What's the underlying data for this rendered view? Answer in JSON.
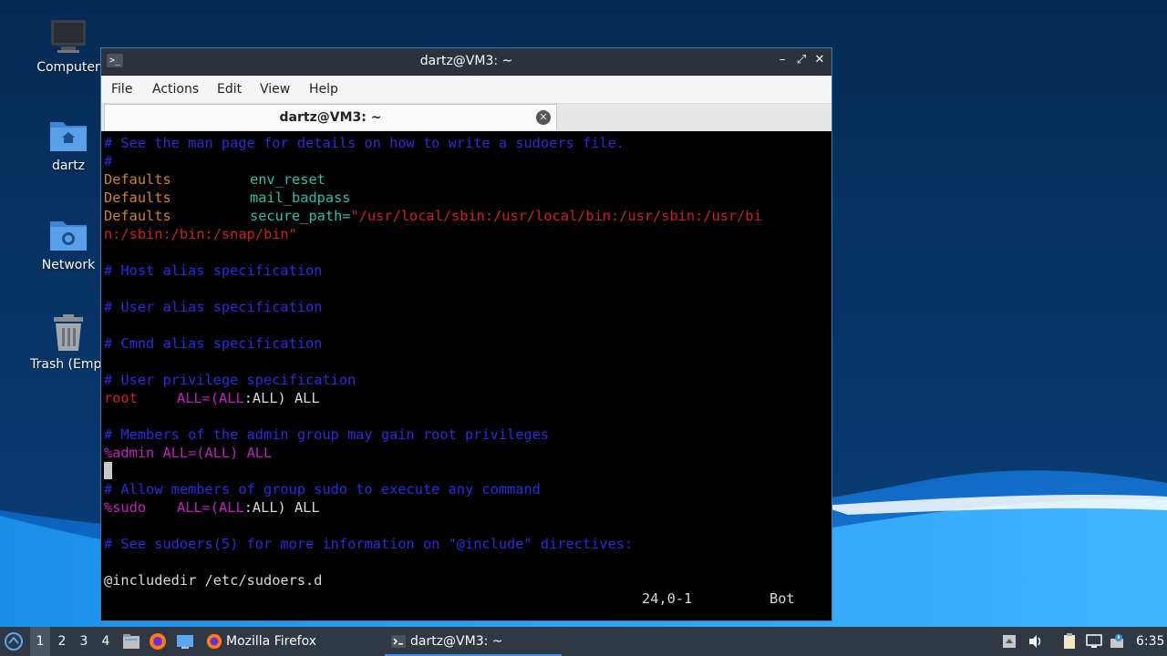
{
  "desktop": {
    "icons": [
      {
        "label": "Computer",
        "icon": "computer-icon"
      },
      {
        "label": "dartz",
        "icon": "home-folder-icon"
      },
      {
        "label": "Network",
        "icon": "network-folder-icon"
      },
      {
        "label": "Trash (Empt",
        "icon": "trash-icon"
      }
    ]
  },
  "window": {
    "title": "dartz@VM3: ~",
    "controls": {
      "minimize": "–",
      "maximize": "⤢",
      "close": "✕"
    },
    "menu": [
      "File",
      "Actions",
      "Edit",
      "View",
      "Help"
    ],
    "tab": {
      "label": "dartz@VM3: ~",
      "close": "✕"
    }
  },
  "terminal": {
    "l01": "# See the man page for details on how to write a sudoers file.",
    "l02": "#",
    "l03a": "Defaults",
    "l03b": "env_reset",
    "l04a": "Defaults",
    "l04b": "mail_badpass",
    "l05a": "Defaults",
    "l05b": "secure_path=",
    "l05c": "\"/usr/local/sbin:/usr/local/bin:/usr/sbin:/usr/bi",
    "l06": "n:/sbin:/bin:/snap/bin\"",
    "l08": "# Host alias specification",
    "l10": "# User alias specification",
    "l12": "# Cmnd alias specification",
    "l14": "# User privilege specification",
    "l15a": "root",
    "l15b": "ALL=(ALL",
    "l15c": ":ALL) ALL",
    "l17": "# Members of the admin group may gain root privileges",
    "l18a": "%admin ALL=(ALL)",
    "l18b": " ALL",
    "l20": "# Allow members of group sudo to execute any command",
    "l21a": "%sudo",
    "l21b": "ALL=(ALL",
    "l21c": ":ALL) ALL",
    "l23": "# See sudoers(5) for more information on \"@include\" directives:",
    "l25": "@includedir /etc/sudoers.d",
    "status_pos": "24,0-1",
    "status_scroll": "Bot"
  },
  "taskbar": {
    "workspaces": [
      "1",
      "2",
      "3",
      "4"
    ],
    "tasks": [
      {
        "label": "Mozilla Firefox",
        "icon": "firefox-icon"
      },
      {
        "label": "dartz@VM3: ~",
        "icon": "terminal-icon"
      }
    ],
    "clock": "6:35"
  },
  "colors": {
    "comment": "#2b2be0",
    "keyword": "#d0822a",
    "option": "#28c0a8",
    "string": "#d02020",
    "identifier": "#c020c0",
    "text": "#d8d8d8"
  }
}
